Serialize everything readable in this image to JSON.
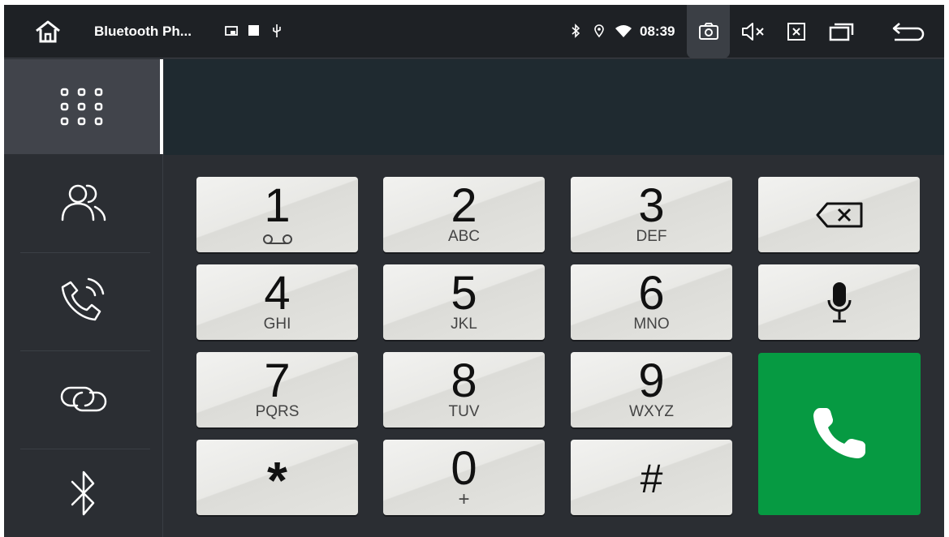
{
  "statusbar": {
    "app_title": "Bluetooth Ph...",
    "time": "08:39"
  },
  "sidebar": {
    "items": [
      {
        "name": "dialpad",
        "icon": "dialpad-grid-icon",
        "active": true
      },
      {
        "name": "contacts",
        "icon": "contacts-icon",
        "active": false
      },
      {
        "name": "call-log",
        "icon": "call-log-icon",
        "active": false
      },
      {
        "name": "pairing",
        "icon": "link-icon",
        "active": false
      },
      {
        "name": "bluetooth",
        "icon": "bluetooth-icon",
        "active": false
      }
    ]
  },
  "display": {
    "number": ""
  },
  "keypad": {
    "keys": [
      {
        "digit": "1",
        "letters": ""
      },
      {
        "digit": "2",
        "letters": "ABC"
      },
      {
        "digit": "3",
        "letters": "DEF"
      },
      {
        "digit": "4",
        "letters": "GHI"
      },
      {
        "digit": "5",
        "letters": "JKL"
      },
      {
        "digit": "6",
        "letters": "MNO"
      },
      {
        "digit": "7",
        "letters": "PQRS"
      },
      {
        "digit": "8",
        "letters": "TUV"
      },
      {
        "digit": "9",
        "letters": "WXYZ"
      },
      {
        "digit": "*",
        "letters": ""
      },
      {
        "digit": "0",
        "letters": "+"
      },
      {
        "digit": "#",
        "letters": ""
      }
    ],
    "side_keys": [
      "backspace-icon",
      "microphone-icon",
      "call-icon"
    ]
  },
  "colors": {
    "call_green": "#069a42",
    "background": "#2b2e33",
    "display": "#1f2a30"
  }
}
